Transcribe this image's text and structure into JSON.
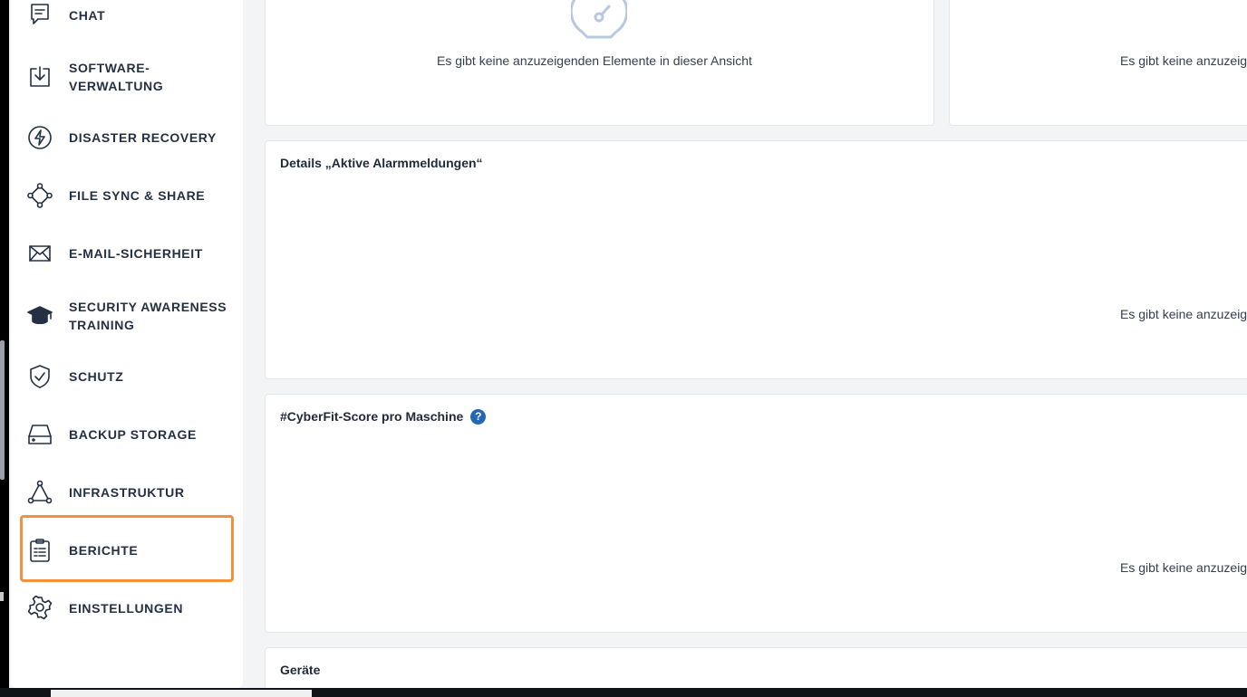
{
  "sidebar": {
    "items": [
      {
        "label": "CHAT",
        "icon": "chat-icon"
      },
      {
        "label_line1": "SOFTWARE-",
        "label_line2": "VERWALTUNG",
        "icon": "software-download-icon"
      },
      {
        "label": "DISASTER RECOVERY",
        "icon": "lightning-icon"
      },
      {
        "label": "FILE SYNC & SHARE",
        "icon": "file-sync-icon"
      },
      {
        "label": "E-MAIL-SICHERHEIT",
        "icon": "envelope-icon"
      },
      {
        "label_line1": "SECURITY AWARENESS",
        "label_line2": "TRAINING",
        "icon": "graduation-cap-icon"
      },
      {
        "label": "SCHUTZ",
        "icon": "shield-check-icon"
      },
      {
        "label": "BACKUP STORAGE",
        "icon": "drive-icon"
      },
      {
        "label": "INFRASTRUKTUR",
        "icon": "network-triangle-icon"
      },
      {
        "label": "BERICHTE",
        "icon": "clipboard-report-icon",
        "highlighted": true
      },
      {
        "label": "EINSTELLUNGEN",
        "icon": "gear-icon"
      }
    ],
    "highlight_color": "#f2913d"
  },
  "main": {
    "top_left_card": {
      "empty_text": "Es gibt keine anzuzeigenden Elemente in dieser Ansicht",
      "icon": "speedometer-icon"
    },
    "top_right_card": {
      "empty_text": "Es gibt keine anzuzeig"
    },
    "alarms_card": {
      "title": "Details „Aktive Alarmmeldungen“",
      "empty_text": "Es gibt keine anzuzeig"
    },
    "cyberfit_card": {
      "title": "#CyberFit-Score pro Maschine",
      "help": "?",
      "empty_text": "Es gibt keine anzuzeig"
    },
    "devices_card": {
      "title": "Geräte"
    }
  },
  "colors": {
    "text_dark": "#243043",
    "help_blue": "#2268b5",
    "icon_light_blue": "#b7c8e0"
  }
}
